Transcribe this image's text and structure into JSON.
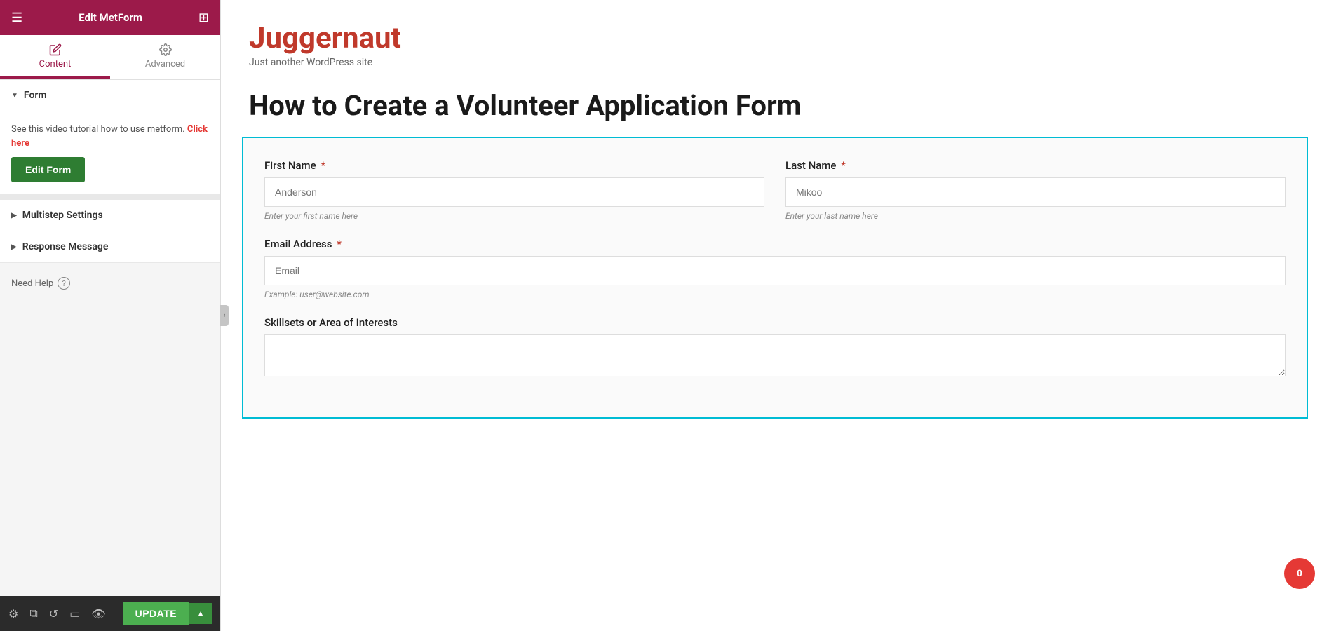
{
  "header": {
    "title": "Edit MetForm",
    "hamburger": "☰",
    "grid": "⊞"
  },
  "tabs": [
    {
      "id": "content",
      "label": "Content",
      "active": true
    },
    {
      "id": "advanced",
      "label": "Advanced",
      "active": false
    }
  ],
  "sidebar": {
    "form_section": {
      "label": "Form",
      "tutorial_text": "See this video tutorial how to use metform.",
      "click_link": "Click here",
      "edit_form_label": "Edit Form"
    },
    "multistep_section": {
      "label": "Multistep Settings"
    },
    "response_section": {
      "label": "Response Message"
    },
    "need_help": "Need Help"
  },
  "bottom_bar": {
    "update_label": "UPDATE",
    "dropdown_arrow": "▲"
  },
  "site": {
    "logo": "Juggernaut",
    "tagline": "Just another WordPress site"
  },
  "page": {
    "title": "How to Create a Volunteer Application Form"
  },
  "form": {
    "fields": [
      {
        "id": "first_name",
        "label": "First Name",
        "required": true,
        "placeholder": "Anderson",
        "hint": "Enter your first name here",
        "type": "text",
        "half": true
      },
      {
        "id": "last_name",
        "label": "Last Name",
        "required": true,
        "placeholder": "Mikoo",
        "hint": "Enter your last name here",
        "type": "text",
        "half": true
      },
      {
        "id": "email",
        "label": "Email Address",
        "required": true,
        "placeholder": "Email",
        "hint": "Example: user@website.com",
        "type": "email",
        "half": false
      },
      {
        "id": "skillsets",
        "label": "Skillsets or Area of Interests",
        "required": false,
        "placeholder": "",
        "hint": "",
        "type": "textarea",
        "half": false
      }
    ]
  },
  "cart": {
    "count": "0"
  }
}
